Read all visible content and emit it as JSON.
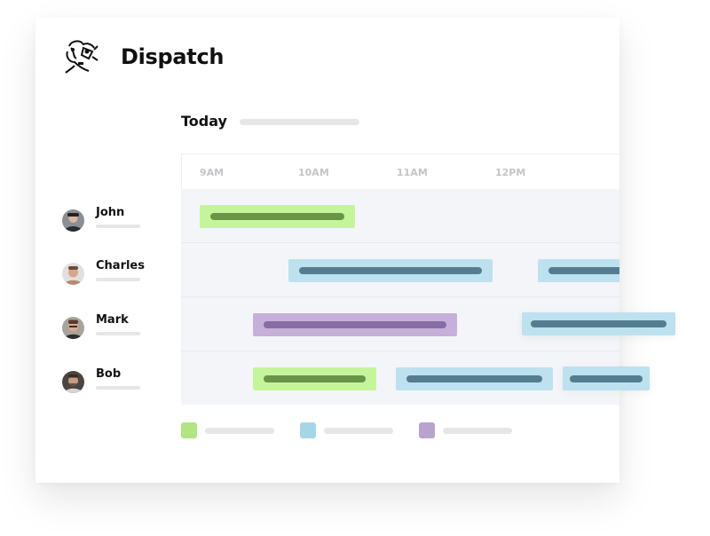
{
  "app": {
    "title": "Dispatch",
    "logo_icon": "armored-knight-icon"
  },
  "schedule": {
    "heading": "Today",
    "time_ticks": [
      "9AM",
      "10AM",
      "11AM",
      "12PM"
    ]
  },
  "people": [
    {
      "name": "John"
    },
    {
      "name": "Charles"
    },
    {
      "name": "Mark"
    },
    {
      "name": "Bob"
    }
  ],
  "colors": {
    "green": "#c5f59a",
    "green_dark": "#6a9448",
    "blue": "#bde1ef",
    "blue_dark": "#547e8f",
    "purple": "#c5b0d9",
    "purple_dark": "#876ba2"
  },
  "legend": [
    {
      "color": "#b1e580",
      "label": ""
    },
    {
      "color": "#a7d5e8",
      "label": ""
    },
    {
      "color": "#b8a3cf",
      "label": ""
    }
  ]
}
